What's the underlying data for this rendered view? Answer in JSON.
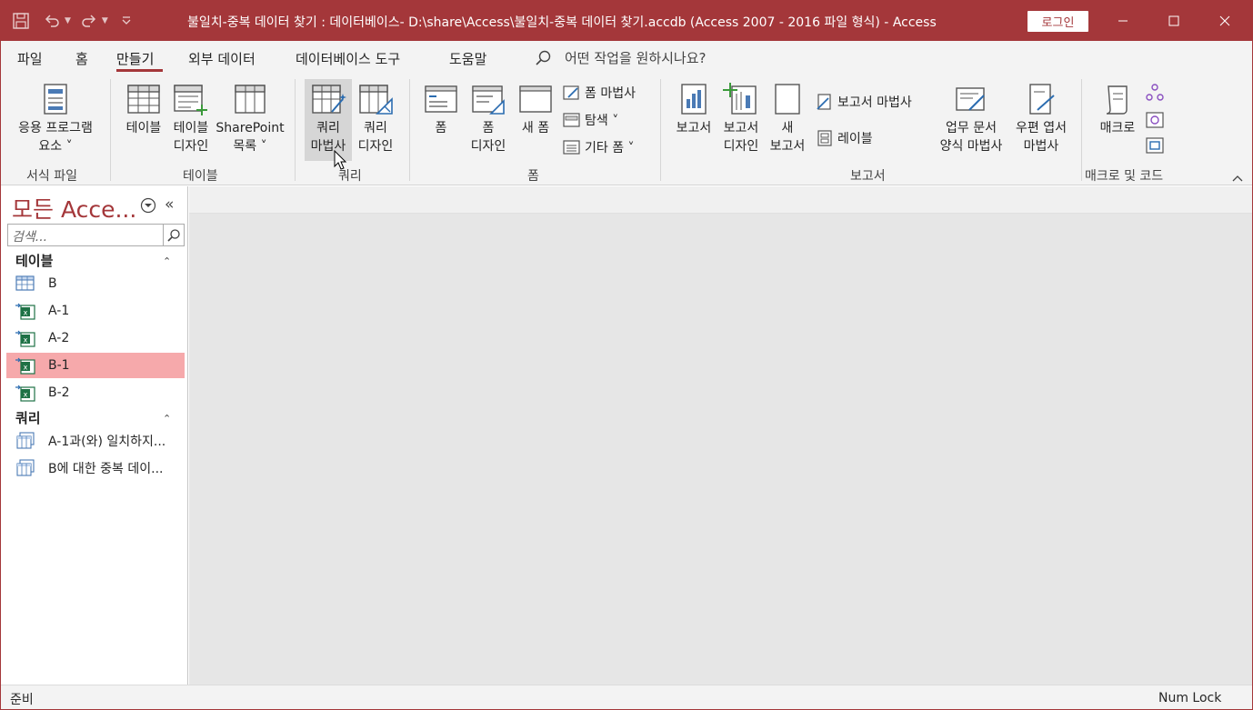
{
  "window": {
    "title": "불일치-중복 데이터 찾기 : 데이터베이스- D:\\share\\Access\\불일치-중복 데이터 찾기.accdb (Access 2007 - 2016 파일 형식)  -  Access",
    "login_label": "로그인"
  },
  "tabs": [
    "파일",
    "홈",
    "만들기",
    "외부 데이터",
    "데이터베이스 도구",
    "도움말"
  ],
  "active_tab": "만들기",
  "tell_me": "어떤 작업을 원하시나요?",
  "ribbon": {
    "app_parts_1": "응용 프로그램",
    "app_parts_2": "요소 ˅",
    "group_templates": "서식 파일",
    "table": "테이블",
    "table_design_1": "테이블",
    "table_design_2": "디자인",
    "sharepoint_1": "SharePoint",
    "sharepoint_2": "목록 ˅",
    "group_tables": "테이블",
    "query_wizard_1": "쿼리",
    "query_wizard_2": "마법사",
    "query_design_1": "쿼리",
    "query_design_2": "디자인",
    "group_queries": "쿼리",
    "form": "폼",
    "form_design_1": "폼",
    "form_design_2": "디자인",
    "blank_form": "새 폼",
    "form_wizard": "폼 마법사",
    "navigation": "탐색 ˅",
    "more_forms": "기타 폼 ˅",
    "group_forms": "폼",
    "report": "보고서",
    "report_design_1": "보고서",
    "report_design_2": "디자인",
    "blank_report_1": "새",
    "blank_report_2": "보고서",
    "report_wizard": "보고서 마법사",
    "labels": "레이블",
    "business_1": "업무 문서",
    "business_2": "양식 마법사",
    "postcard_1": "우편 엽서",
    "postcard_2": "마법사",
    "group_reports": "보고서",
    "macro": "매크로",
    "group_macros": "매크로 및 코드"
  },
  "nav": {
    "title": "모든 Acce...",
    "search_placeholder": "검색...",
    "group_tables": "테이블",
    "tables": [
      {
        "name": "B",
        "type": "local"
      },
      {
        "name": "A-1",
        "type": "linked-excel"
      },
      {
        "name": "A-2",
        "type": "linked-excel"
      },
      {
        "name": "B-1",
        "type": "linked-excel"
      },
      {
        "name": "B-2",
        "type": "linked-excel"
      }
    ],
    "group_queries": "쿼리",
    "queries": [
      {
        "name": "A-1과(와) 일치하지..."
      },
      {
        "name": "B에 대한 중복 데이..."
      }
    ],
    "selected": "B-1"
  },
  "status": {
    "left": "준비",
    "right": "Num Lock"
  },
  "colors": {
    "accent": "#a4373a",
    "selection": "#f6a9ab"
  }
}
